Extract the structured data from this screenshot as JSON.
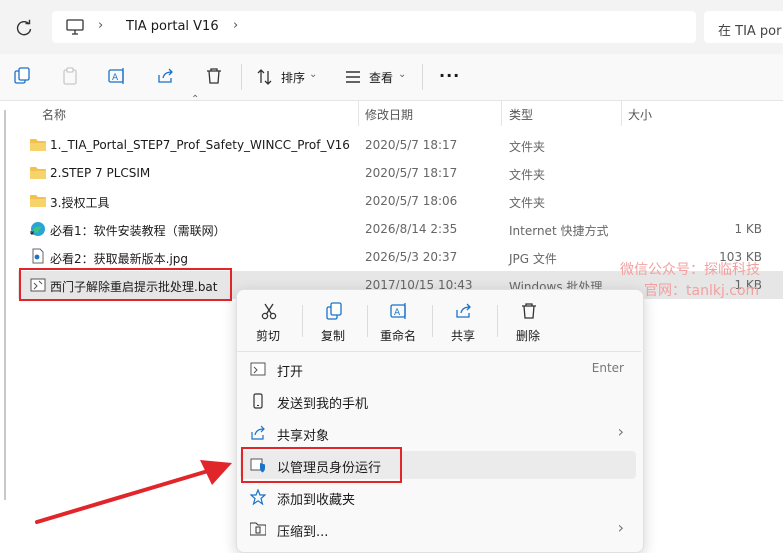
{
  "address": {
    "breadcrumb": "TIA portal V16",
    "search_placeholder": "在 TIA por"
  },
  "toolbar": {
    "sort_label": "排序",
    "view_label": "查看",
    "more_label": "···"
  },
  "columns": {
    "name": "名称",
    "date": "修改日期",
    "type": "类型",
    "size": "大小"
  },
  "files": [
    {
      "name": "1._TIA_Portal_STEP7_Prof_Safety_WINCC_Prof_V16",
      "date": "2020/5/7 18:17",
      "type": "文件夹",
      "size": "",
      "icon": "folder-icon"
    },
    {
      "name": "2.STEP 7 PLCSIM",
      "date": "2020/5/7 18:17",
      "type": "文件夹",
      "size": "",
      "icon": "folder-icon"
    },
    {
      "name": "3.授权工具",
      "date": "2020/5/7 18:06",
      "type": "文件夹",
      "size": "",
      "icon": "folder-icon"
    },
    {
      "name": "必看1：软件安装教程（需联网）",
      "date": "2026/8/14 2:35",
      "type": "Internet 快捷方式",
      "size": "1 KB",
      "icon": "edge-icon"
    },
    {
      "name": "必看2：获取最新版本.jpg",
      "date": "2026/5/3 20:37",
      "type": "JPG 文件",
      "size": "103 KB",
      "icon": "image-file-icon"
    },
    {
      "name": "西门子解除重启提示批处理.bat",
      "date": "2017/10/15 10:43",
      "type": "Windows 批处理...",
      "size": "1 KB",
      "icon": "bat-file-icon"
    }
  ],
  "watermark": {
    "line1": "微信公众号：探临科技",
    "line2": "官网：tanlkj.com"
  },
  "context_menu": {
    "quick_actions": [
      {
        "label": "剪切",
        "icon": "scissors-icon"
      },
      {
        "label": "复制",
        "icon": "copy-icon"
      },
      {
        "label": "重命名",
        "icon": "rename-icon"
      },
      {
        "label": "共享",
        "icon": "share-icon"
      },
      {
        "label": "删除",
        "icon": "trash-icon"
      }
    ],
    "items": [
      {
        "label": "打开",
        "shortcut": "Enter",
        "icon": "open-icon"
      },
      {
        "label": "发送到我的手机",
        "shortcut": "",
        "icon": "phone-icon"
      },
      {
        "label": "共享对象",
        "shortcut": "›",
        "icon": "share-icon"
      },
      {
        "label": "以管理员身份运行",
        "shortcut": "",
        "icon": "admin-shield-icon"
      },
      {
        "label": "添加到收藏夹",
        "shortcut": "",
        "icon": "star-icon"
      },
      {
        "label": "压缩到...",
        "shortcut": "›",
        "icon": "zip-icon"
      }
    ]
  },
  "colors": {
    "highlight": "#e0262a",
    "folder": "#f2c14e",
    "accent": "#1a73c7"
  }
}
